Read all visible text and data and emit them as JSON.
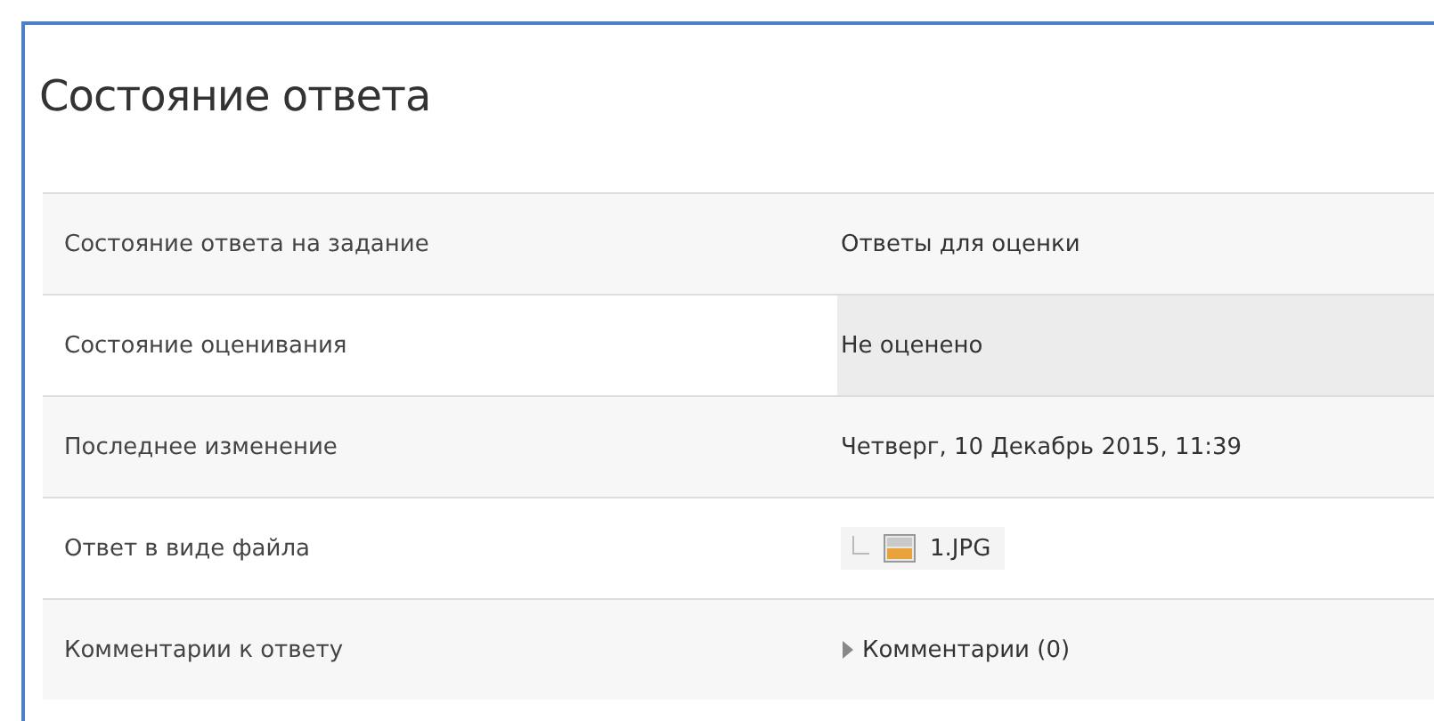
{
  "title": "Состояние ответа",
  "rows": [
    {
      "label": "Состояние ответа на задание",
      "kind": "text",
      "value": "Ответы для оценки"
    },
    {
      "label": "Состояние оценивания",
      "kind": "text",
      "value": "Не оценено",
      "highlight": true
    },
    {
      "label": "Последнее изменение",
      "kind": "text",
      "value": "Четверг, 10 Декабрь 2015, 11:39"
    },
    {
      "label": "Ответ в виде файла",
      "kind": "file",
      "value": "1.JPG"
    },
    {
      "label": "Комментарии к ответу",
      "kind": "comments",
      "value": "Комментарии (0)",
      "expanded": false
    }
  ]
}
